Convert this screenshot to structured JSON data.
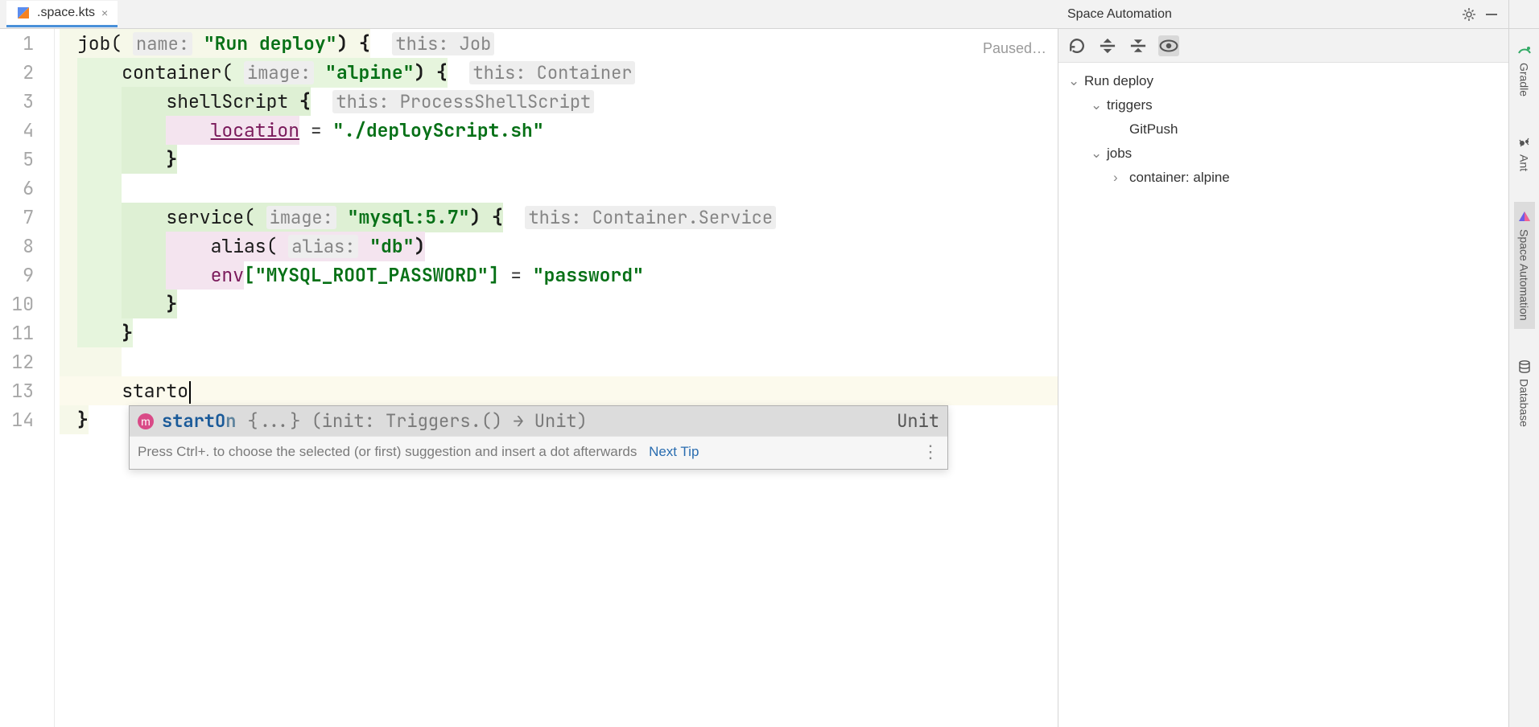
{
  "tab": {
    "filename": ".space.kts"
  },
  "editor": {
    "status": "Paused…",
    "lines": {
      "l1": {
        "ind": "",
        "fn": "job(",
        "inlay": "name:",
        "str": "\"Run deploy\"",
        "rest": ") {",
        "inlay2": "this: Job"
      },
      "l2": {
        "ind": "    ",
        "fn": "container(",
        "inlay": "image:",
        "str": "\"alpine\"",
        "rest": ") {",
        "inlay2": "this: Container"
      },
      "l3": {
        "ind": "        ",
        "fn": "shellScript ",
        "brace": "{",
        "inlay2": "this: ProcessShellScript"
      },
      "l4": {
        "ind": "            ",
        "ident": "location",
        "eq": " = ",
        "str": "\"./deployScript.sh\""
      },
      "l5": {
        "ind": "        ",
        "brace": "}"
      },
      "l6": {
        "ind": ""
      },
      "l7": {
        "ind": "        ",
        "fn": "service(",
        "inlay": "image:",
        "str": "\"mysql:5.7\"",
        "rest": ") {",
        "inlay2": "this: Container.Service"
      },
      "l8": {
        "ind": "            ",
        "fn": "alias(",
        "inlay": "alias:",
        "str": "\"db\"",
        "rest": ")"
      },
      "l9": {
        "ind": "            ",
        "ident": "env",
        "idx": "[\"MYSQL_ROOT_PASSWORD\"]",
        "eq": " = ",
        "str": "\"password\""
      },
      "l10": {
        "ind": "        ",
        "brace": "}"
      },
      "l11": {
        "ind": "    ",
        "brace": "}"
      },
      "l12": {
        "ind": ""
      },
      "l13": {
        "ind": "    ",
        "typed": "starto"
      },
      "l14": {
        "ind": "",
        "brace": "}"
      }
    }
  },
  "autocomplete": {
    "name_bold": "startO",
    "name_tail": "n",
    "sig": " {...} (init: Triggers.() → Unit)",
    "ret": "Unit",
    "hint_text": "Press Ctrl+. to choose the selected (or first) suggestion and insert a dot afterwards",
    "hint_link": "Next Tip"
  },
  "panel": {
    "title": "Space Automation",
    "tree": {
      "root": "Run deploy",
      "triggers_label": "triggers",
      "triggers_item": "GitPush",
      "jobs_label": "jobs",
      "jobs_item": "container: alpine"
    }
  },
  "right_rail": {
    "gradle": "Gradle",
    "ant": "Ant",
    "space": "Space Automation",
    "database": "Database"
  },
  "line_numbers": [
    "1",
    "2",
    "3",
    "4",
    "5",
    "6",
    "7",
    "8",
    "9",
    "10",
    "11",
    "12",
    "13",
    "14"
  ]
}
